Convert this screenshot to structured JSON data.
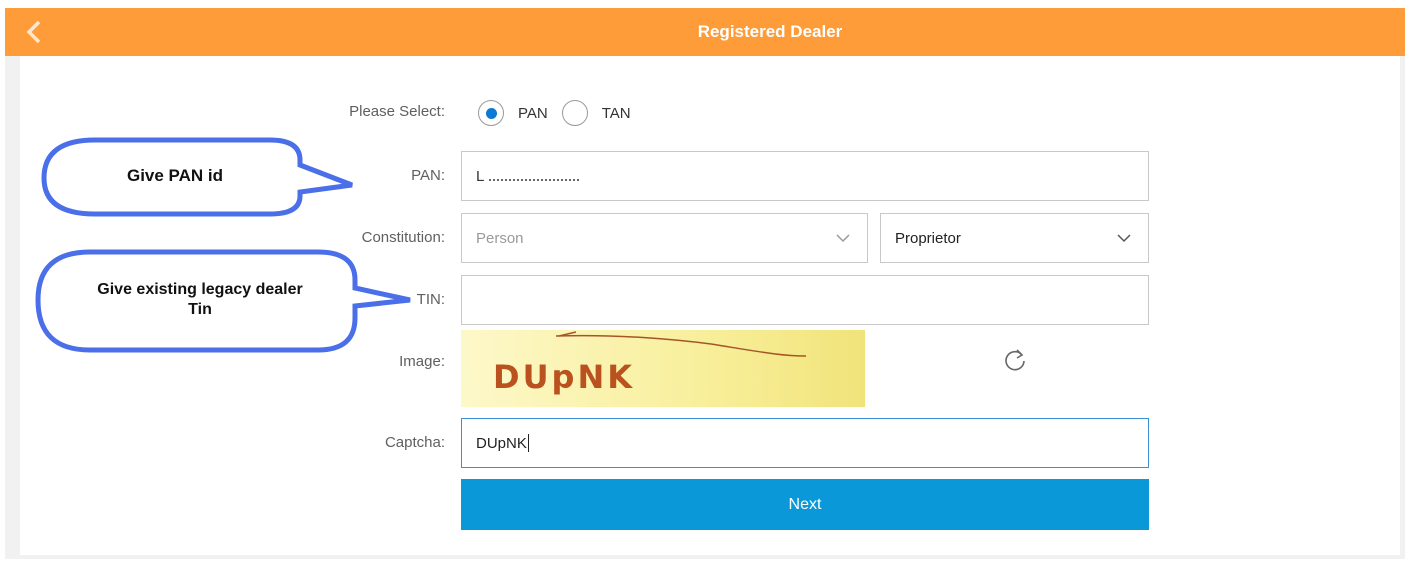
{
  "header": {
    "title": "Registered Dealer",
    "back_icon": "chevron-left-icon",
    "bg_color": "#fd9c38"
  },
  "form": {
    "please_select_label": "Please Select:",
    "radio_options": [
      {
        "label": "PAN",
        "selected": true
      },
      {
        "label": "TAN",
        "selected": false
      }
    ],
    "pan_label": "PAN:",
    "pan_value": "L",
    "constitution_label": "Constitution:",
    "constitution_value": "Person",
    "constitution_sub_value": "Proprietor",
    "tin_label": "TIN:",
    "tin_value": "",
    "image_label": "Image:",
    "captcha_image_text": "DUpNK",
    "refresh_icon": "refresh-icon",
    "captcha_label": "Captcha:",
    "captcha_value": "DUpNK",
    "next_label": "Next",
    "accent_color": "#0a98d8"
  },
  "annotations": {
    "callout_pan": "Give PAN id",
    "callout_tin": "Give existing legacy dealer Tin"
  }
}
